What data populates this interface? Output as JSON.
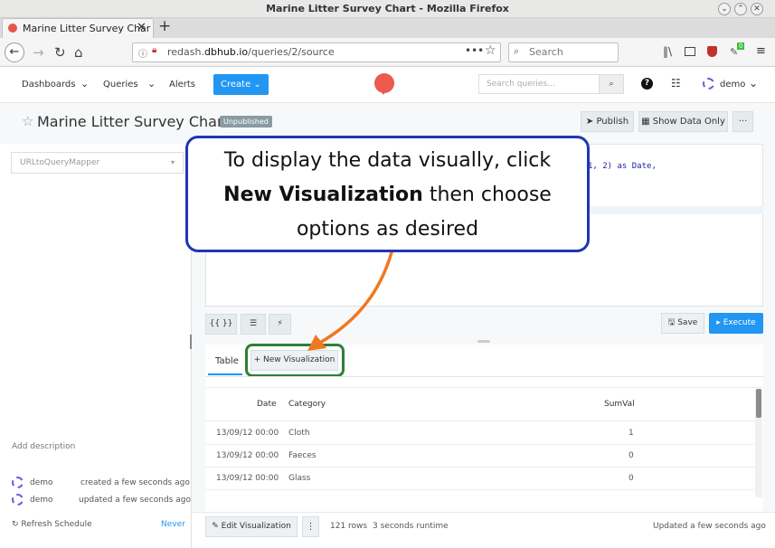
{
  "window": {
    "title": "Marine Litter Survey Chart - Mozilla Firefox"
  },
  "browser": {
    "tab_title": "Marine Litter Survey Char",
    "url_prefix": "redash.",
    "url_domain": "dbhub.io",
    "url_path": "/queries/2/source",
    "search_placeholder": "Search",
    "addon_badge": "0",
    "icons": [
      "back-icon",
      "forward-icon",
      "reload-icon",
      "home-icon",
      "info-icon",
      "bookmark-star-icon",
      "library-icon",
      "sidebar-icon",
      "shield-icon",
      "menu-icon"
    ]
  },
  "app": {
    "nav": {
      "dashboards": "Dashboards",
      "queries": "Queries",
      "alerts": "Alerts",
      "create": "Create"
    },
    "search_placeholder": "Search queries...",
    "user": "demo"
  },
  "query": {
    "title": "Marine Litter Survey Chart",
    "badge": "Unpublished",
    "publish": "Publish",
    "show_data_only": "Show Data Only",
    "more": "···",
    "schema_select": "URLtoQueryMapper",
    "code_fragment": "1, 2) as Date,",
    "editor_buttons": {
      "params": "{{ }}",
      "format": "☰",
      "autocomplete": "⚡"
    },
    "save": "Save",
    "execute": "Execute"
  },
  "sidebar": {
    "add_description": "Add description",
    "created_user": "demo",
    "created_text": "created a few seconds ago",
    "updated_user": "demo",
    "updated_text": "updated a few seconds ago",
    "refresh_label": "Refresh Schedule",
    "refresh_value": "Never"
  },
  "results": {
    "tab_table": "Table",
    "new_visualization": "+ New Visualization",
    "columns": [
      "Date",
      "Category",
      "SumVal"
    ],
    "rows": [
      {
        "date": "13/09/12 00:00",
        "category": "Cloth",
        "sum": "1"
      },
      {
        "date": "13/09/12 00:00",
        "category": "Faeces",
        "sum": "0"
      },
      {
        "date": "13/09/12 00:00",
        "category": "Glass",
        "sum": "0"
      }
    ],
    "edit_visualization": "Edit Visualization",
    "kebab": "⋮",
    "row_count": "121 rows",
    "runtime": "3 seconds runtime",
    "updated": "Updated a few seconds ago"
  },
  "callout": {
    "line1": "To display the data visually, click",
    "bold": "New Visualization",
    "line2_rest": " then choose",
    "line3": "options as desired"
  },
  "colors": {
    "accent": "#2196f3",
    "callout_border": "#1f36b5",
    "arrow": "#f07820",
    "highlight": "#2f7f36"
  }
}
